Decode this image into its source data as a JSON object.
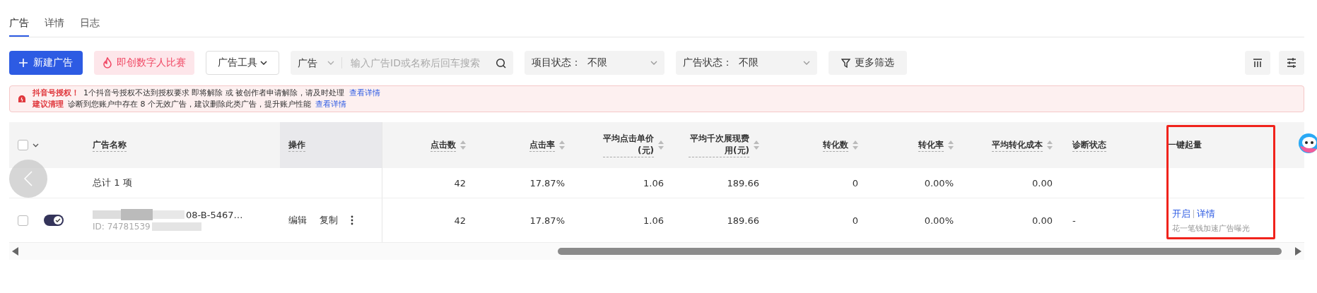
{
  "tabs": [
    {
      "label": "广告",
      "selected": true
    },
    {
      "label": "详情",
      "selected": false
    },
    {
      "label": "日志",
      "selected": false
    }
  ],
  "toolbar": {
    "new_button": "新建广告",
    "promo_button": "即创数字人比赛",
    "tools_dropdown": "广告工具",
    "search": {
      "scope": "广告",
      "placeholder": "输入广告ID或名称后回车搜索"
    },
    "filters": [
      {
        "label": "项目状态：",
        "value": "不限"
      },
      {
        "label": "广告状态：",
        "value": "不限"
      }
    ],
    "more_filters": "更多筛选"
  },
  "alerts": [
    {
      "title": "抖音号授权！",
      "message": "1个抖音号授权不达到授权要求 即将解除 或 被创作者申请解除，请及时处理",
      "link": "查看详情"
    },
    {
      "title": "建议清理",
      "message": "诊断到您账户中存在 8 个无效广告，建议删除此类广告，提升账户性能",
      "link": "查看详情"
    }
  ],
  "table": {
    "columns": [
      {
        "label": "广告名称",
        "sortable": false
      },
      {
        "label": "操作",
        "sortable": false
      },
      {
        "label": "点击数",
        "sortable": true
      },
      {
        "label": "点击率",
        "sortable": true
      },
      {
        "label": "平均点击单价(元)",
        "sortable": true
      },
      {
        "label": "平均千次展现费用(元)",
        "sortable": true
      },
      {
        "label": "转化数",
        "sortable": true
      },
      {
        "label": "转化率",
        "sortable": true
      },
      {
        "label": "平均转化成本",
        "sortable": true
      },
      {
        "label": "诊断状态",
        "sortable": false
      },
      {
        "label": "一键起量",
        "sortable": false
      }
    ],
    "all_checked": false,
    "total_row": {
      "label": "总计 1 项",
      "metrics": [
        "42",
        "17.87%",
        "1.06",
        "189.66",
        "0",
        "0.00%",
        "0.00"
      ]
    },
    "rows": [
      {
        "checked": false,
        "on": true,
        "name": "08-B-5467…",
        "id": "ID: 74781539",
        "actions": [
          "编辑",
          "复制"
        ],
        "metrics": [
          "42",
          "17.87%",
          "1.06",
          "189.66",
          "0",
          "0.00%",
          "0.00"
        ],
        "diagnosis": "-",
        "boost_links": [
          "开启",
          "详情"
        ],
        "boost_note": "花一笔钱加速广告曝光"
      }
    ]
  }
}
